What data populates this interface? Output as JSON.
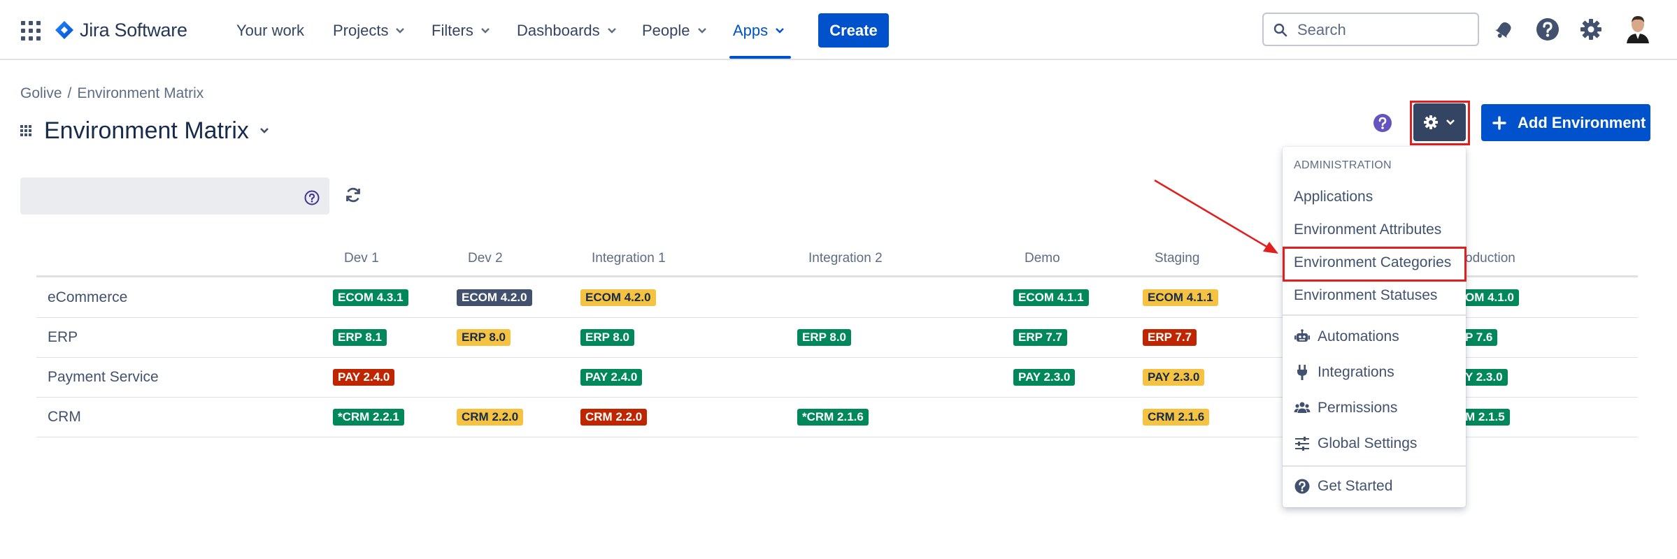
{
  "nav": {
    "product": "Jira Software",
    "items": [
      {
        "label": "Your work",
        "dropdown": false
      },
      {
        "label": "Projects",
        "dropdown": true
      },
      {
        "label": "Filters",
        "dropdown": true
      },
      {
        "label": "Dashboards",
        "dropdown": true
      },
      {
        "label": "People",
        "dropdown": true
      },
      {
        "label": "Apps",
        "dropdown": true,
        "active": true
      }
    ],
    "create_label": "Create",
    "search_placeholder": "Search"
  },
  "breadcrumb": {
    "project": "Golive",
    "page": "Environment Matrix"
  },
  "page_title": "Environment Matrix",
  "toolbar": {
    "add_environment_label": "Add Environment"
  },
  "matrix": {
    "columns": [
      "Dev 1",
      "Dev 2",
      "Integration 1",
      "Integration 2",
      "Demo",
      "Staging",
      "oduction"
    ],
    "rows": [
      {
        "name": "eCommerce",
        "cells": [
          {
            "text": "ECOM 4.3.1",
            "color": "green"
          },
          {
            "text": "ECOM 4.2.0",
            "color": "dark"
          },
          {
            "text": "ECOM 4.2.0",
            "color": "yellow"
          },
          null,
          {
            "text": "ECOM 4.1.1",
            "color": "green"
          },
          {
            "text": "ECOM 4.1.1",
            "color": "yellow"
          },
          {
            "text": "OM 4.1.0",
            "color": "green"
          }
        ]
      },
      {
        "name": "ERP",
        "cells": [
          {
            "text": "ERP 8.1",
            "color": "green"
          },
          {
            "text": "ERP 8.0",
            "color": "yellow"
          },
          {
            "text": "ERP 8.0",
            "color": "green"
          },
          {
            "text": "ERP 8.0",
            "color": "green"
          },
          {
            "text": "ERP 7.7",
            "color": "green"
          },
          {
            "text": "ERP 7.7",
            "color": "red"
          },
          {
            "text": "P 7.6",
            "color": "green"
          }
        ]
      },
      {
        "name": "Payment Service",
        "cells": [
          {
            "text": "PAY 2.4.0",
            "color": "red"
          },
          null,
          {
            "text": "PAY 2.4.0",
            "color": "green"
          },
          null,
          {
            "text": "PAY 2.3.0",
            "color": "green"
          },
          {
            "text": "PAY 2.3.0",
            "color": "yellow"
          },
          {
            "text": "Y 2.3.0",
            "color": "green"
          }
        ]
      },
      {
        "name": "CRM",
        "cells": [
          {
            "text": "*CRM 2.2.1",
            "color": "green"
          },
          {
            "text": "CRM 2.2.0",
            "color": "yellow"
          },
          {
            "text": "CRM 2.2.0",
            "color": "red"
          },
          {
            "text": "*CRM 2.1.6",
            "color": "green"
          },
          null,
          {
            "text": "CRM 2.1.6",
            "color": "yellow"
          },
          {
            "text": "M 2.1.5",
            "color": "green"
          }
        ]
      }
    ]
  },
  "admin_menu": {
    "section_label": "ADMINISTRATION",
    "items": [
      "Applications",
      "Environment Attributes",
      "Environment Categories",
      "Environment Statuses"
    ],
    "more_items": [
      {
        "label": "Automations",
        "icon": "robot-icon"
      },
      {
        "label": "Integrations",
        "icon": "plug-icon"
      },
      {
        "label": "Permissions",
        "icon": "users-icon"
      },
      {
        "label": "Global Settings",
        "icon": "sliders-icon"
      }
    ],
    "footer_item": {
      "label": "Get Started",
      "icon": "question-circle-icon"
    }
  },
  "colors": {
    "primary": "#0052cc",
    "badge_green": "#00875a",
    "badge_dark": "#42526e",
    "badge_yellow": "#f5c242",
    "badge_red": "#bf2600",
    "annotation_red": "#e11f1f"
  }
}
